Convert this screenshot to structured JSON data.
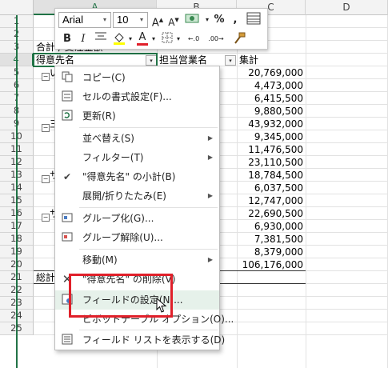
{
  "columns": [
    "A",
    "B",
    "C",
    "D"
  ],
  "rows": [
    "1",
    "2",
    "3",
    "4",
    "5",
    "6",
    "7",
    "8",
    "9",
    "10",
    "11",
    "12",
    "13",
    "14",
    "15",
    "16",
    "17",
    "18",
    "19",
    "20",
    "21",
    "22",
    "23",
    "24",
    "25"
  ],
  "cells": {
    "a3": "合計 / 受注金額",
    "a4": "得意先名",
    "b4": "担当営業名",
    "c4": "集計",
    "a5": "い",
    "a9": "三",
    "a13": "サ",
    "a16": "サ",
    "a20": "総計"
  },
  "values": [
    "20,769,000",
    "4,473,000",
    "6,415,500",
    "9,880,500",
    "43,932,000",
    "9,345,000",
    "11,476,500",
    "23,110,500",
    "18,784,500",
    "6,037,500",
    "12,747,000",
    "22,690,500",
    "6,930,000",
    "7,381,500",
    "8,379,000",
    "106,176,000"
  ],
  "mini_toolbar": {
    "font_name": "Arial",
    "font_size": "10",
    "grow_font": "A",
    "shrink_font": "A",
    "percent": "%",
    "comma": ",",
    "bold": "B",
    "italic": "I",
    "font_color_letter": "A",
    "increase_decimal": "←.0",
    "decrease_decimal": ".00→"
  },
  "context_menu": {
    "items": [
      {
        "label": "コピー(C)",
        "icon": "copy-icon"
      },
      {
        "label": "セルの書式設定(F)...",
        "icon": "format-cells-icon"
      },
      {
        "label": "更新(R)",
        "icon": "refresh-icon"
      },
      {
        "label": "並べ替え(S)",
        "icon": "",
        "submenu": true
      },
      {
        "label": "フィルター(T)",
        "icon": "",
        "submenu": true
      },
      {
        "label": "\"得意先名\" の小計(B)",
        "icon": "checkmark-icon"
      },
      {
        "label": "展開/折りたたみ(E)",
        "icon": "",
        "submenu": true
      },
      {
        "label": "グループ化(G)...",
        "icon": "group-icon"
      },
      {
        "label": "グループ解除(U)...",
        "icon": "ungroup-icon"
      },
      {
        "label": "移動(M)",
        "icon": "",
        "submenu": true
      },
      {
        "label": "\"得意先名\" の削除(V)",
        "icon": "remove-x-icon"
      },
      {
        "label": "フィールドの設定(N)...",
        "icon": "field-settings-icon"
      },
      {
        "label": "ピボットテーブル オプション(O)...",
        "icon": ""
      },
      {
        "label": "フィールド リストを表示する(D)",
        "icon": "field-list-icon"
      }
    ]
  },
  "colors": {
    "accent": "#217346",
    "highlight": "#e6f1ea",
    "callout_border": "#e0202a"
  }
}
